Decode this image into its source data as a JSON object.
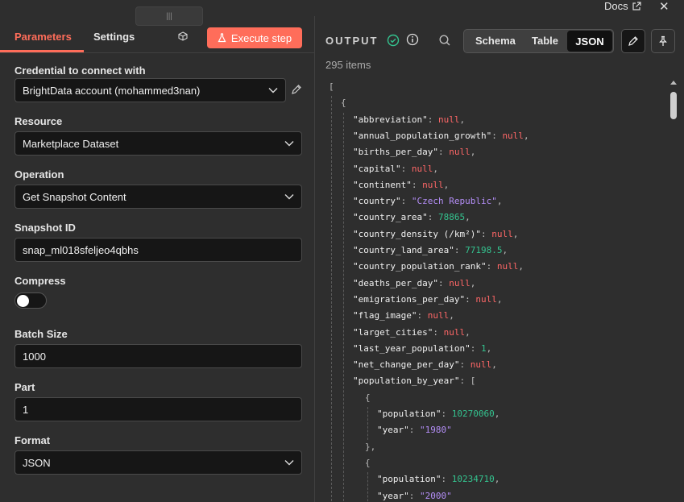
{
  "header": {
    "docs_label": "Docs",
    "close_glyph": "✕",
    "handle_glyph": "|||"
  },
  "left_panel": {
    "tabs": {
      "parameters": "Parameters",
      "settings": "Settings"
    },
    "execute_label": "Execute step",
    "fields": {
      "credential": {
        "label": "Credential to connect with",
        "value": "BrightData account (mohammed3nan)"
      },
      "resource": {
        "label": "Resource",
        "value": "Marketplace Dataset"
      },
      "operation": {
        "label": "Operation",
        "value": "Get Snapshot Content"
      },
      "snapshot": {
        "label": "Snapshot ID",
        "value": "snap_ml018sfeljeo4qbhs"
      },
      "compress": {
        "label": "Compress",
        "enabled": false
      },
      "batch_size": {
        "label": "Batch Size",
        "value": "1000"
      },
      "part": {
        "label": "Part",
        "value": "1"
      },
      "format": {
        "label": "Format",
        "value": "JSON"
      }
    }
  },
  "right_panel": {
    "title": "OUTPUT",
    "items_count": "295 items",
    "views": {
      "schema": "Schema",
      "table": "Table",
      "json": "JSON",
      "active": "JSON"
    },
    "json_lines": [
      {
        "indent": 0,
        "parts": [
          {
            "t": "p",
            "v": "["
          }
        ]
      },
      {
        "indent": 1,
        "parts": [
          {
            "t": "p",
            "v": "{"
          }
        ]
      },
      {
        "indent": 2,
        "parts": [
          {
            "t": "k",
            "v": "\"abbreviation\""
          },
          {
            "t": "p",
            "v": ": "
          },
          {
            "t": "n",
            "v": "null"
          },
          {
            "t": "p",
            "v": ","
          }
        ]
      },
      {
        "indent": 2,
        "parts": [
          {
            "t": "k",
            "v": "\"annual_population_growth\""
          },
          {
            "t": "p",
            "v": ": "
          },
          {
            "t": "n",
            "v": "null"
          },
          {
            "t": "p",
            "v": ","
          }
        ]
      },
      {
        "indent": 2,
        "parts": [
          {
            "t": "k",
            "v": "\"births_per_day\""
          },
          {
            "t": "p",
            "v": ": "
          },
          {
            "t": "n",
            "v": "null"
          },
          {
            "t": "p",
            "v": ","
          }
        ]
      },
      {
        "indent": 2,
        "parts": [
          {
            "t": "k",
            "v": "\"capital\""
          },
          {
            "t": "p",
            "v": ": "
          },
          {
            "t": "n",
            "v": "null"
          },
          {
            "t": "p",
            "v": ","
          }
        ]
      },
      {
        "indent": 2,
        "parts": [
          {
            "t": "k",
            "v": "\"continent\""
          },
          {
            "t": "p",
            "v": ": "
          },
          {
            "t": "n",
            "v": "null"
          },
          {
            "t": "p",
            "v": ","
          }
        ]
      },
      {
        "indent": 2,
        "parts": [
          {
            "t": "k",
            "v": "\"country\""
          },
          {
            "t": "p",
            "v": ": "
          },
          {
            "t": "s",
            "v": "\"Czech Republic\""
          },
          {
            "t": "p",
            "v": ","
          }
        ]
      },
      {
        "indent": 2,
        "parts": [
          {
            "t": "k",
            "v": "\"country_area\""
          },
          {
            "t": "p",
            "v": ": "
          },
          {
            "t": "num",
            "v": "78865"
          },
          {
            "t": "p",
            "v": ","
          }
        ]
      },
      {
        "indent": 2,
        "parts": [
          {
            "t": "k",
            "v": "\"country_density (/km²)\""
          },
          {
            "t": "p",
            "v": ": "
          },
          {
            "t": "n",
            "v": "null"
          },
          {
            "t": "p",
            "v": ","
          }
        ]
      },
      {
        "indent": 2,
        "parts": [
          {
            "t": "k",
            "v": "\"country_land_area\""
          },
          {
            "t": "p",
            "v": ": "
          },
          {
            "t": "num",
            "v": "77198.5"
          },
          {
            "t": "p",
            "v": ","
          }
        ]
      },
      {
        "indent": 2,
        "parts": [
          {
            "t": "k",
            "v": "\"country_population_rank\""
          },
          {
            "t": "p",
            "v": ": "
          },
          {
            "t": "n",
            "v": "null"
          },
          {
            "t": "p",
            "v": ","
          }
        ]
      },
      {
        "indent": 2,
        "parts": [
          {
            "t": "k",
            "v": "\"deaths_per_day\""
          },
          {
            "t": "p",
            "v": ": "
          },
          {
            "t": "n",
            "v": "null"
          },
          {
            "t": "p",
            "v": ","
          }
        ]
      },
      {
        "indent": 2,
        "parts": [
          {
            "t": "k",
            "v": "\"emigrations_per_day\""
          },
          {
            "t": "p",
            "v": ": "
          },
          {
            "t": "n",
            "v": "null"
          },
          {
            "t": "p",
            "v": ","
          }
        ]
      },
      {
        "indent": 2,
        "parts": [
          {
            "t": "k",
            "v": "\"flag_image\""
          },
          {
            "t": "p",
            "v": ": "
          },
          {
            "t": "n",
            "v": "null"
          },
          {
            "t": "p",
            "v": ","
          }
        ]
      },
      {
        "indent": 2,
        "parts": [
          {
            "t": "k",
            "v": "\"larget_cities\""
          },
          {
            "t": "p",
            "v": ": "
          },
          {
            "t": "n",
            "v": "null"
          },
          {
            "t": "p",
            "v": ","
          }
        ]
      },
      {
        "indent": 2,
        "parts": [
          {
            "t": "k",
            "v": "\"last_year_population\""
          },
          {
            "t": "p",
            "v": ": "
          },
          {
            "t": "num",
            "v": "1"
          },
          {
            "t": "p",
            "v": ","
          }
        ]
      },
      {
        "indent": 2,
        "parts": [
          {
            "t": "k",
            "v": "\"net_change_per_day\""
          },
          {
            "t": "p",
            "v": ": "
          },
          {
            "t": "n",
            "v": "null"
          },
          {
            "t": "p",
            "v": ","
          }
        ]
      },
      {
        "indent": 2,
        "parts": [
          {
            "t": "k",
            "v": "\"population_by_year\""
          },
          {
            "t": "p",
            "v": ": ["
          }
        ]
      },
      {
        "indent": 3,
        "parts": [
          {
            "t": "p",
            "v": "{"
          }
        ]
      },
      {
        "indent": 4,
        "parts": [
          {
            "t": "k",
            "v": "\"population\""
          },
          {
            "t": "p",
            "v": ": "
          },
          {
            "t": "num",
            "v": "10270060"
          },
          {
            "t": "p",
            "v": ","
          }
        ]
      },
      {
        "indent": 4,
        "parts": [
          {
            "t": "k",
            "v": "\"year\""
          },
          {
            "t": "p",
            "v": ": "
          },
          {
            "t": "s",
            "v": "\"1980\""
          }
        ]
      },
      {
        "indent": 3,
        "parts": [
          {
            "t": "p",
            "v": "},"
          }
        ]
      },
      {
        "indent": 3,
        "parts": [
          {
            "t": "p",
            "v": "{"
          }
        ]
      },
      {
        "indent": 4,
        "parts": [
          {
            "t": "k",
            "v": "\"population\""
          },
          {
            "t": "p",
            "v": ": "
          },
          {
            "t": "num",
            "v": "10234710"
          },
          {
            "t": "p",
            "v": ","
          }
        ]
      },
      {
        "indent": 4,
        "parts": [
          {
            "t": "k",
            "v": "\"year\""
          },
          {
            "t": "p",
            "v": ": "
          },
          {
            "t": "s",
            "v": "\"2000\""
          }
        ]
      }
    ]
  },
  "colors": {
    "accent": "#ff6d5a",
    "success": "#34c38f",
    "json_null": "#ff6767",
    "json_string": "#b48ef7",
    "json_number": "#34c38f",
    "panel_bg": "#2e2e2e",
    "input_bg": "#161616"
  },
  "icons": {
    "docs": "external-link-icon",
    "close": "close-icon",
    "node": "cube-icon",
    "execute": "flask-icon",
    "edit_credential": "pencil-icon",
    "dropdown": "chevron-down-icon",
    "status": "check-circle-icon",
    "info": "info-icon",
    "search": "search-icon",
    "edit_output": "pencil-icon",
    "pin": "pin-icon"
  }
}
